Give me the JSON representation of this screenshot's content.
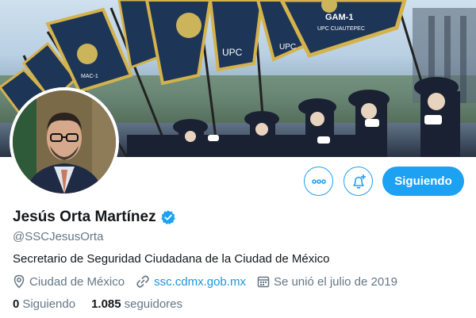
{
  "profile": {
    "name": "Jesús Orta Martínez",
    "handle": "@SSCJesusOrta",
    "bio": "Secretario de Seguridad Ciudadana de la Ciudad de México",
    "location": "Ciudad de México",
    "website": "ssc.cdmx.gob.mx",
    "joined": "Se unió el julio de 2019",
    "following_count": "0",
    "following_label": "Siguiendo",
    "followers_count": "1.085",
    "followers_label": "seguidores",
    "verified": true
  },
  "actions": {
    "more_icon": "more-icon",
    "notify_icon": "bell-plus-icon",
    "follow_label": "Siguiendo"
  },
  "banner": {
    "flags": [
      "UPC",
      "GAM-1",
      "UPC CUAUTEPEC",
      "UPC",
      "MAC-1"
    ]
  },
  "colors": {
    "accent": "#1da1f2",
    "link": "#1b95e0",
    "secondary_text": "#657786",
    "primary_text": "#14171a",
    "flag_navy": "#1d3557",
    "flag_fringe": "#d4b24c"
  }
}
